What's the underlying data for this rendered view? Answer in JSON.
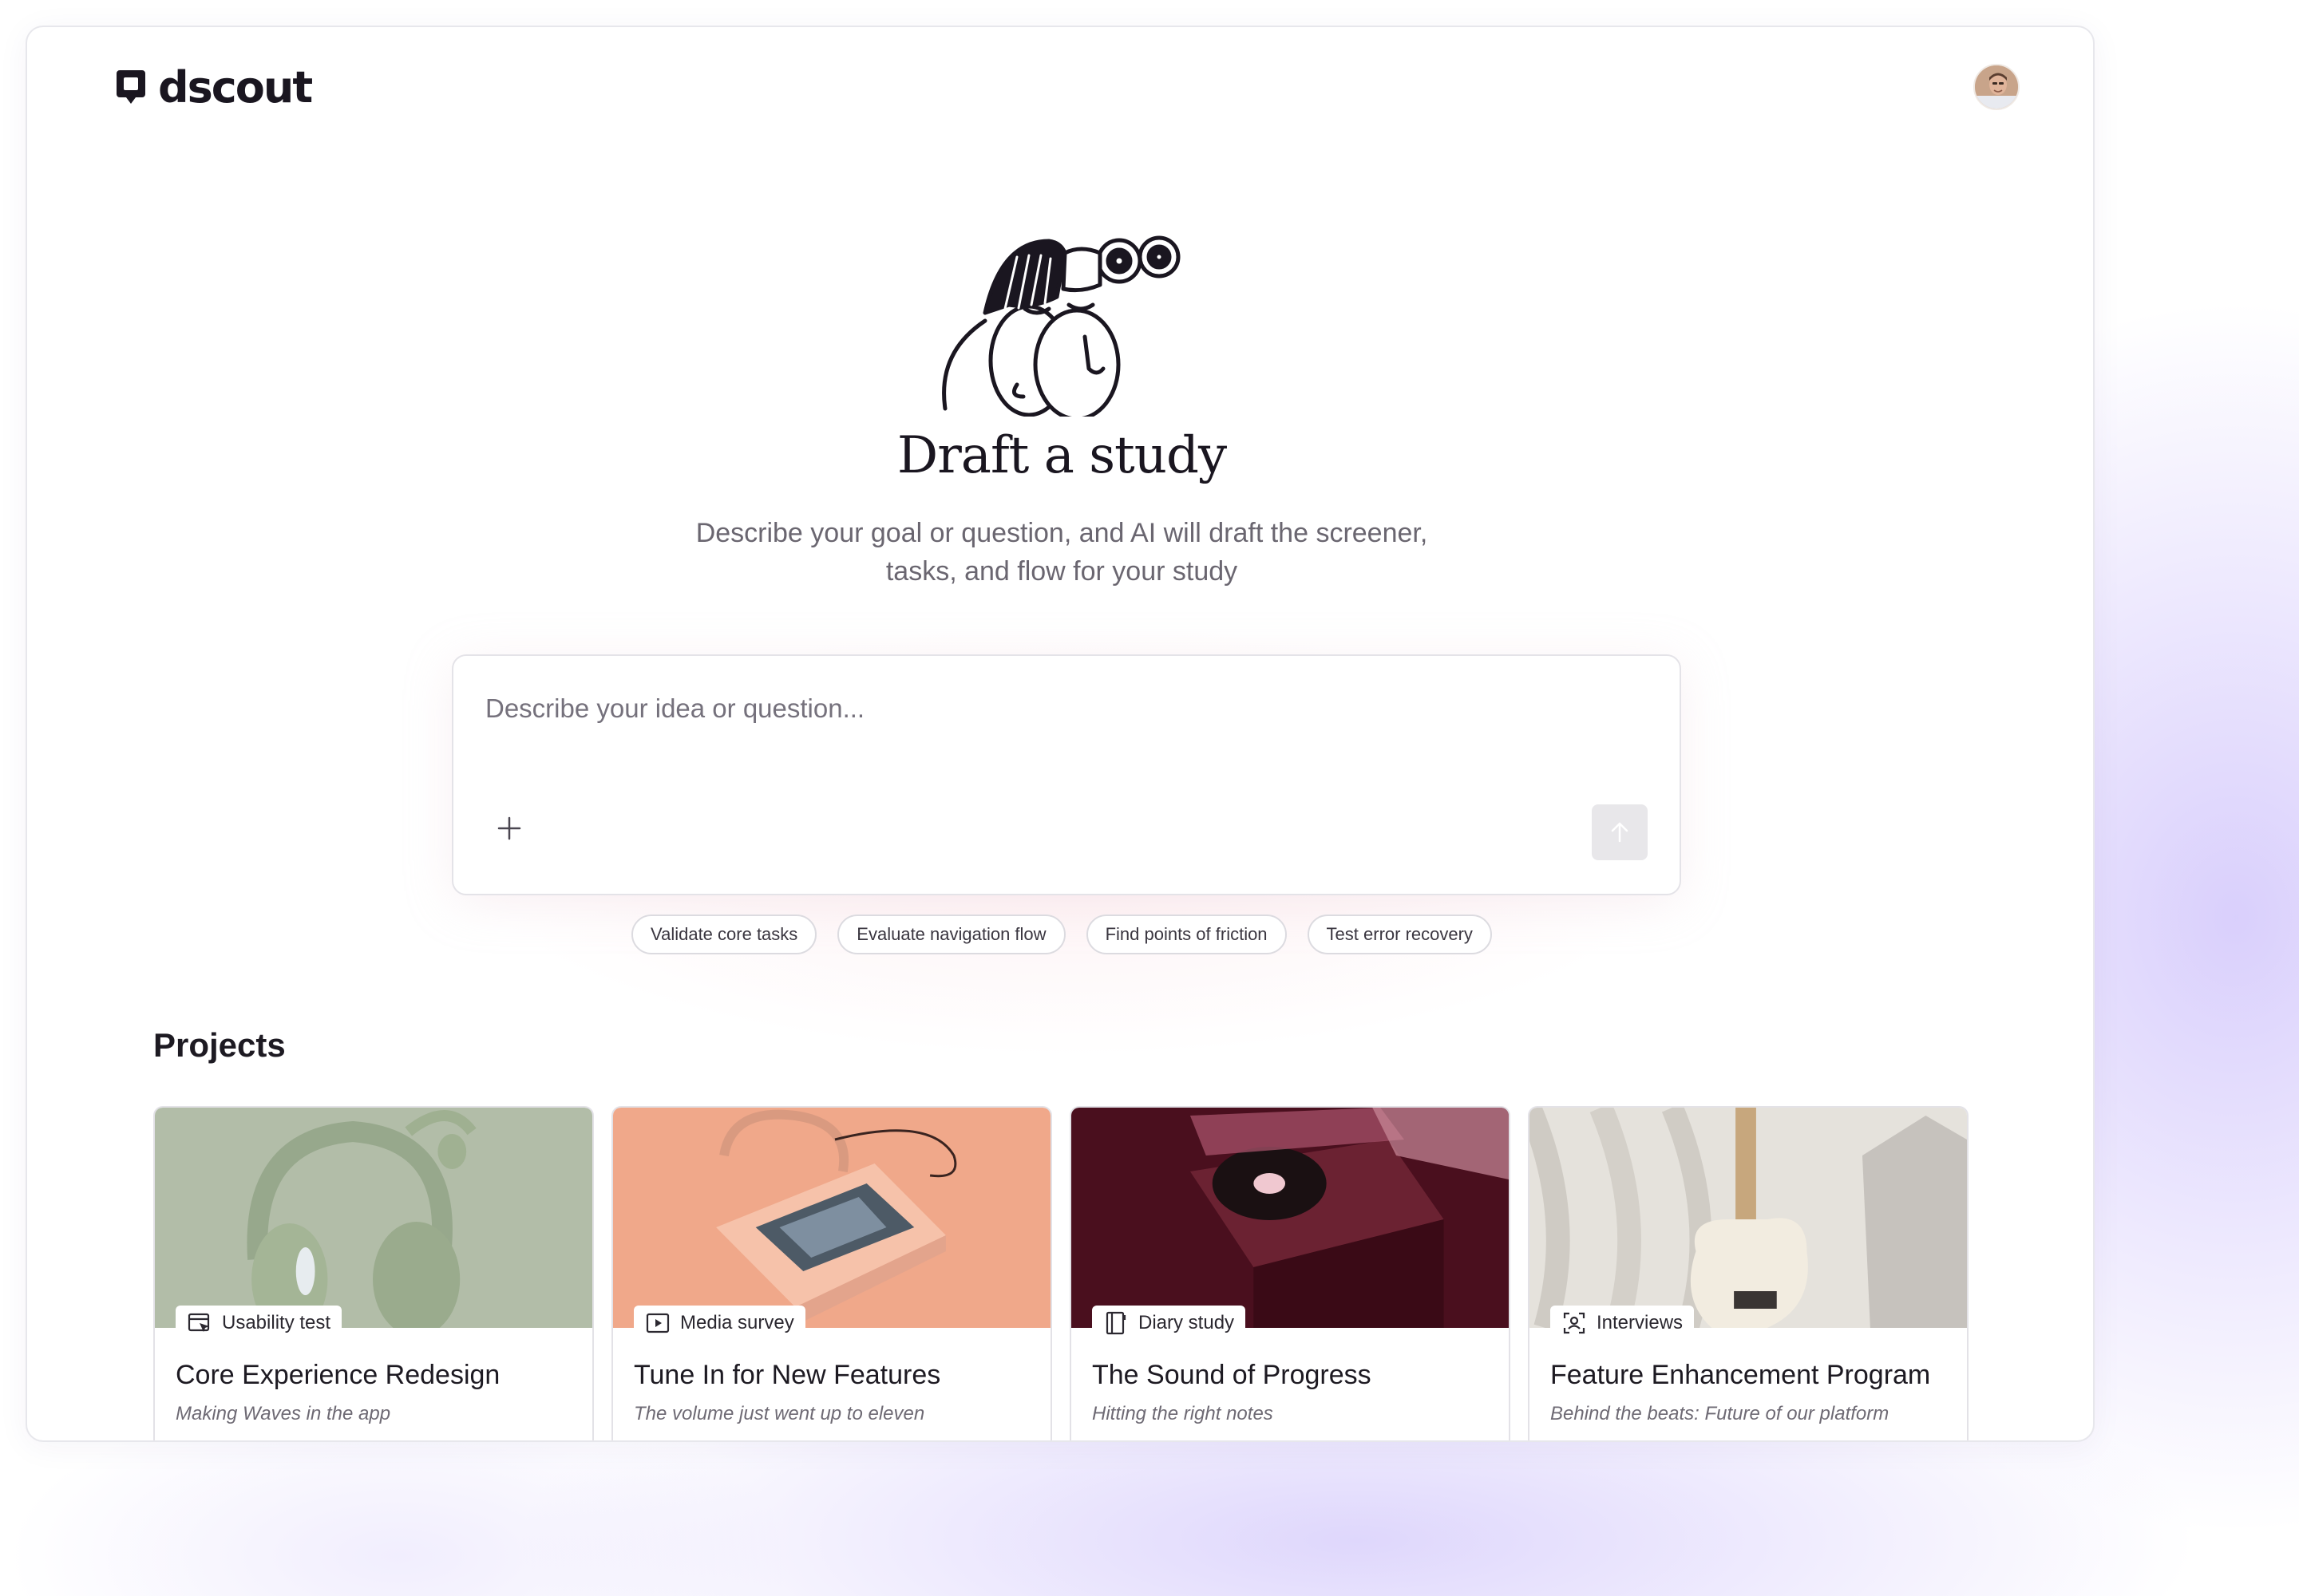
{
  "app": {
    "name": "dscout"
  },
  "hero": {
    "title": "Draft a study",
    "subtitle": "Describe your goal or question, and AI will draft the screener, tasks, and flow for your study"
  },
  "composer": {
    "placeholder": "Describe your idea or question...",
    "value": "",
    "add_icon": "plus-icon",
    "send_icon": "arrow-up-icon"
  },
  "suggestions": [
    "Validate core tasks",
    "Evaluate navigation flow",
    "Find points of friction",
    "Test error recovery"
  ],
  "projects": {
    "heading": "Projects",
    "items": [
      {
        "type": "Usability test",
        "type_icon": "usability-test-icon",
        "title": "Core Experience Redesign",
        "subtitle": "Making Waves in the app",
        "image": "green-headphones"
      },
      {
        "type": "Media survey",
        "type_icon": "media-survey-icon",
        "title": "Tune In for New Features",
        "subtitle": "The volume just went up to eleven",
        "image": "peach-cassette-player"
      },
      {
        "type": "Diary study",
        "type_icon": "diary-study-icon",
        "title": "The Sound of Progress",
        "subtitle": "Hitting the right notes",
        "image": "burgundy-turntable"
      },
      {
        "type": "Interviews",
        "type_icon": "interviews-icon",
        "title": "Feature Enhancement Program",
        "subtitle": "Behind the beats: Future of our platform",
        "image": "cream-electric-guitar"
      }
    ]
  },
  "colors": {
    "brand_text": "#1a1620",
    "muted_text": "#6a6670",
    "border": "#e4e3e8",
    "send_button_disabled": "#e8e7ea",
    "backdrop_glow": "#c4b6fa"
  }
}
